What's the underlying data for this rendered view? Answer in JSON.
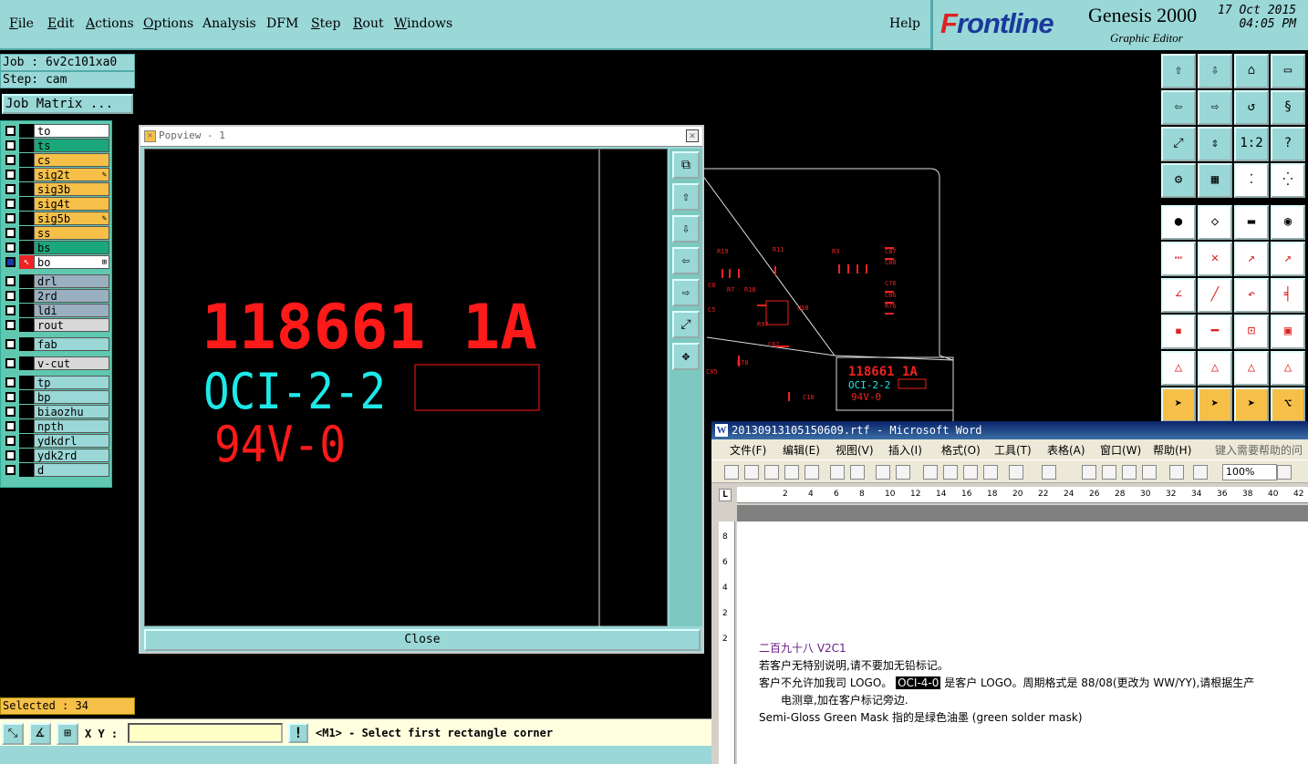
{
  "menubar": {
    "items": [
      {
        "label": "File",
        "u": "F",
        "rest": "ile"
      },
      {
        "label": "Edit",
        "u": "E",
        "rest": "dit"
      },
      {
        "label": "Actions",
        "u": "A",
        "rest": "ctions"
      },
      {
        "label": "Options",
        "u": "O",
        "rest": "ptions"
      },
      {
        "label": "Analysis",
        "u": "",
        "rest": "Analysis"
      },
      {
        "label": "DFM",
        "u": "",
        "rest": "DFM"
      },
      {
        "label": "Step",
        "u": "S",
        "rest": "tep"
      },
      {
        "label": "Rout",
        "u": "R",
        "rest": "out"
      },
      {
        "label": "Windows",
        "u": "W",
        "rest": "indows"
      }
    ],
    "help": "Help"
  },
  "brand": {
    "logo_f": "F",
    "logo_rest": "rontline",
    "product": "Genesis 2000",
    "subtitle": "Graphic Editor",
    "date": "17 Oct 2015",
    "time": "04:05 PM"
  },
  "job": {
    "job_line": "Job : 6v2c101xa0",
    "step_line": "Step: cam",
    "matrix_button": "Job Matrix ..."
  },
  "layers": [
    {
      "name": "to",
      "color": "#ffffff",
      "mark": ""
    },
    {
      "name": "ts",
      "color": "#1aa87a",
      "mark": ""
    },
    {
      "name": "cs",
      "color": "#f6c048",
      "mark": ""
    },
    {
      "name": "sig2t",
      "color": "#f6c048",
      "mark": "✎"
    },
    {
      "name": "sig3b",
      "color": "#f6c048",
      "mark": ""
    },
    {
      "name": "sig4t",
      "color": "#f6c048",
      "mark": ""
    },
    {
      "name": "sig5b",
      "color": "#f6c048",
      "mark": "✎"
    },
    {
      "name": "ss",
      "color": "#f6c048",
      "mark": ""
    },
    {
      "name": "bs",
      "color": "#1aa87a",
      "mark": ""
    },
    {
      "name": "bo",
      "color": "#ffffff",
      "mark": "⊞",
      "active": true
    },
    {
      "name": "drl",
      "color": "#9ab0c0",
      "mark": ""
    },
    {
      "name": "2rd",
      "color": "#9ab0c0",
      "mark": ""
    },
    {
      "name": "ldi",
      "color": "#9ab0c0",
      "mark": ""
    },
    {
      "name": "rout",
      "color": "#d8d8d8",
      "mark": ""
    },
    {
      "name": "fab",
      "color": "#9ad7d7",
      "mark": ""
    },
    {
      "name": "v-cut",
      "color": "#d8d8d8",
      "mark": ""
    },
    {
      "name": "tp",
      "color": "#9ad7d7",
      "mark": ""
    },
    {
      "name": "bp",
      "color": "#9ad7d7",
      "mark": ""
    },
    {
      "name": "biaozhu",
      "color": "#9ad7d7",
      "mark": ""
    },
    {
      "name": "npth",
      "color": "#9ad7d7",
      "mark": ""
    },
    {
      "name": "ydkdrl",
      "color": "#9ad7d7",
      "mark": ""
    },
    {
      "name": "ydk2rd",
      "color": "#9ad7d7",
      "mark": ""
    },
    {
      "name": "d",
      "color": "#9ad7d7",
      "mark": ""
    }
  ],
  "status": {
    "selected": "Selected : 34",
    "xy_label": "X Y :",
    "xy_value": "",
    "prompt": "<M1> - Select first rectangle corner"
  },
  "popview": {
    "title": "Popview - 1",
    "line1": "118661 1A",
    "line2": "OCI-2-2",
    "line3": "94V-0",
    "close": "Close"
  },
  "pcb": {
    "labels": [
      "R19",
      "R11",
      "R3",
      "C87",
      "C88",
      "C76",
      "C86",
      "R76",
      "U18",
      "R97",
      "C62",
      "C85",
      "R78",
      "C18",
      "C8",
      "R18",
      "R7",
      "C5"
    ],
    "mini1": "118661 1A",
    "mini2": "OCI-2-2",
    "mini3": "94V-0"
  },
  "word": {
    "title": "20130913105150609.rtf - Microsoft Word",
    "menus": [
      "文件(F)",
      "编辑(E)",
      "视图(V)",
      "插入(I)",
      "格式(O)",
      "工具(T)",
      "表格(A)",
      "窗口(W)",
      "帮助(H)"
    ],
    "help_box": "键入需要帮助的问题",
    "zoom": "100%",
    "ruler": [
      "2",
      "4",
      "6",
      "8",
      "10",
      "12",
      "14",
      "16",
      "18",
      "20",
      "22",
      "24",
      "26",
      "28",
      "30",
      "32",
      "34",
      "36",
      "38",
      "40",
      "42"
    ],
    "vruler": [
      "8",
      "6",
      "4",
      "2",
      "2"
    ],
    "doc": {
      "heading": "二百九十八 V2C1",
      "p1": "若客户无特别说明,请不要加无铅标记。",
      "p2_a": "客户不允许加我司 LOGO。",
      "p2_hl": "OCI-4-0",
      "p2_b": "是客户 LOGO。周期格式是 88/08(更改为 WW/YY),请根据生产",
      "p3": "电测章,加在客户标记旁边.",
      "p4": "Semi-Gloss Green Mask 指的是绿色油墨 (green solder mask)"
    }
  },
  "colors": {
    "panel": "#9ad7d7",
    "red": "#ff1a1a",
    "cyan": "#1ee8e8",
    "yellow": "#f6c048"
  }
}
